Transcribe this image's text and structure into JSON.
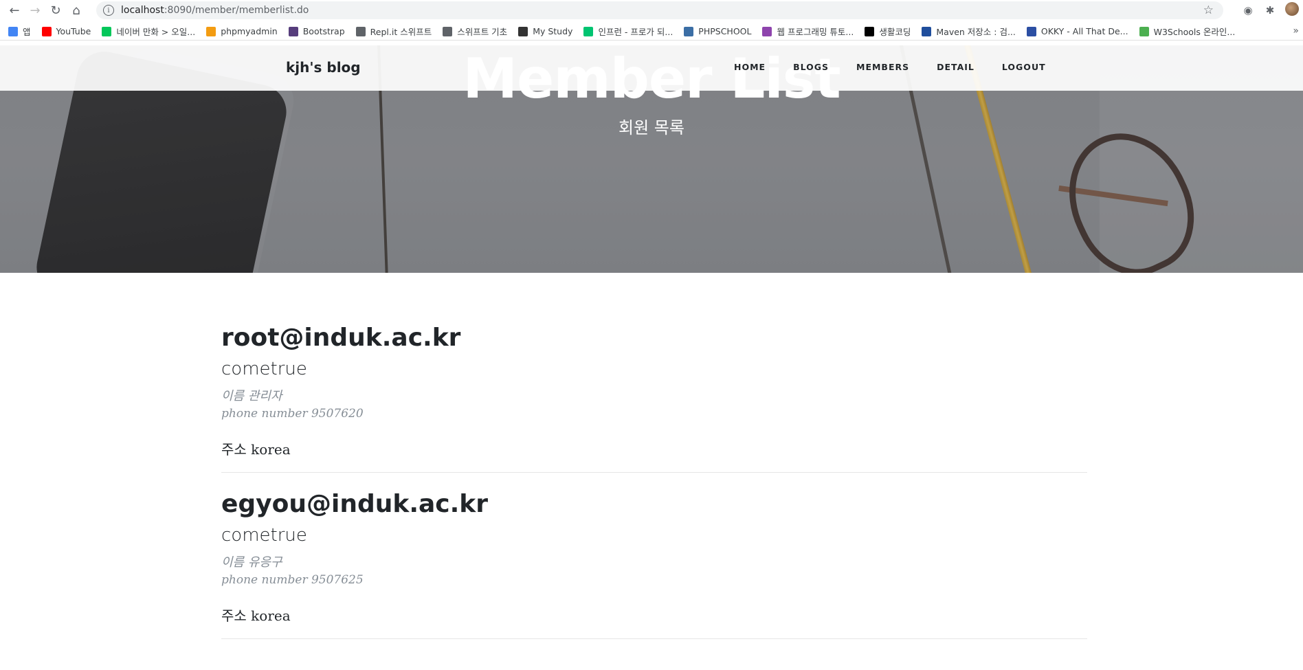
{
  "browser": {
    "url_host": "localhost",
    "url_path": ":8090/member/memberlist.do",
    "bookmarks": [
      {
        "label": "앱",
        "color": "#4285f4"
      },
      {
        "label": "YouTube",
        "color": "#ff0000"
      },
      {
        "label": "네이버 만화 > 오일...",
        "color": "#03c75a"
      },
      {
        "label": "phpmyadmin",
        "color": "#f39c12"
      },
      {
        "label": "Bootstrap",
        "color": "#563d7c"
      },
      {
        "label": "Repl.it 스위프트",
        "color": "#5f6368"
      },
      {
        "label": "스위프트 기초",
        "color": "#5f6368"
      },
      {
        "label": "My Study",
        "color": "#333333"
      },
      {
        "label": "인프런 - 프로가 되...",
        "color": "#00c471"
      },
      {
        "label": "PHPSCHOOL",
        "color": "#3b6ea5"
      },
      {
        "label": "웹 프로그래밍 튜토...",
        "color": "#8e44ad"
      },
      {
        "label": "생활코딩",
        "color": "#000000"
      },
      {
        "label": "Maven 저장소 : 검...",
        "color": "#1f4e9c"
      },
      {
        "label": "OKKY - All That De...",
        "color": "#2c4fa3"
      },
      {
        "label": "W3Schools 온라인...",
        "color": "#4caf50"
      }
    ]
  },
  "navbar": {
    "brand": "kjh's blog",
    "links": [
      "HOME",
      "BLOGS",
      "MEMBERS",
      "DETAIL",
      "LOGOUT"
    ]
  },
  "header": {
    "title": "Member List",
    "subtitle": "회원 목록"
  },
  "members": [
    {
      "email": "root@induk.ac.kr",
      "password": "cometrue",
      "name": "이름 관리자",
      "phone": "phone number 9507620",
      "address": "주소 korea"
    },
    {
      "email": "egyou@induk.ac.kr",
      "password": "cometrue",
      "name": "이름 유응구",
      "phone": "phone number 9507625",
      "address": "주소 korea"
    }
  ]
}
